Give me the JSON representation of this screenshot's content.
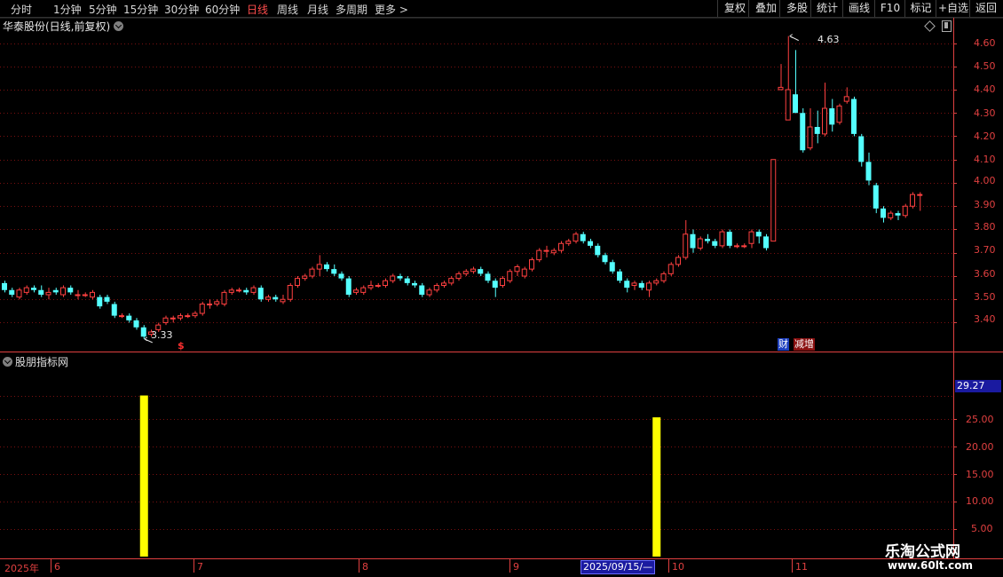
{
  "toolbar": {
    "periods": [
      "分时",
      "1分钟",
      "5分钟",
      "15分钟",
      "30分钟",
      "60分钟",
      "日线",
      "周线",
      "月线",
      "多周期",
      "更多 >"
    ],
    "active_period": "日线",
    "buttons": [
      "复权",
      "叠加",
      "多股",
      "统计",
      "画线",
      "F10",
      "标记",
      "+自选",
      "返回"
    ]
  },
  "chart": {
    "title": "华泰股份(日线,前复权)",
    "high_label": "4.63",
    "low_label": "3.33",
    "price_axis_ticks": [
      "4.60",
      "4.50",
      "4.40",
      "4.30",
      "4.20",
      "4.10",
      "4.00",
      "3.90",
      "3.80",
      "3.70",
      "3.60",
      "3.50",
      "3.40"
    ],
    "badges": {
      "cai": "财",
      "zeng": "减增"
    },
    "marker": "$"
  },
  "indicator": {
    "title": "股朋指标网",
    "current_value": "29.27",
    "axis_ticks": [
      "25.00",
      "20.00",
      "15.00",
      "10.00",
      "5.00"
    ]
  },
  "date_axis": {
    "year": "2025年",
    "months": [
      "6",
      "7",
      "8",
      "9",
      "10",
      "11"
    ],
    "cursor_date": "2025/09/15/—"
  },
  "watermark": {
    "name": "乐淘公式网",
    "url": "www.60lt.com"
  },
  "colors": {
    "up": "#ff4040",
    "down": "#54ffff",
    "indicator_bar": "#ffff00",
    "axis": "#e04040",
    "grid": "#7a1010"
  },
  "chart_data": {
    "type": "candlestick",
    "y_range": [
      3.3,
      4.66
    ],
    "candles": [
      [
        3.57,
        3.58,
        3.53,
        3.54
      ],
      [
        3.54,
        3.55,
        3.51,
        3.52
      ],
      [
        3.51,
        3.55,
        3.5,
        3.54
      ],
      [
        3.53,
        3.56,
        3.52,
        3.55
      ],
      [
        3.55,
        3.56,
        3.53,
        3.54
      ],
      [
        3.54,
        3.56,
        3.51,
        3.52
      ],
      [
        3.52,
        3.55,
        3.5,
        3.53
      ],
      [
        3.54,
        3.55,
        3.52,
        3.53
      ],
      [
        3.52,
        3.56,
        3.51,
        3.55
      ],
      [
        3.55,
        3.56,
        3.52,
        3.53
      ],
      [
        3.52,
        3.54,
        3.5,
        3.52
      ],
      [
        3.52,
        3.53,
        3.51,
        3.52
      ],
      [
        3.51,
        3.54,
        3.5,
        3.53
      ],
      [
        3.51,
        3.52,
        3.46,
        3.47
      ],
      [
        3.51,
        3.52,
        3.48,
        3.49
      ],
      [
        3.48,
        3.49,
        3.42,
        3.43
      ],
      [
        3.43,
        3.44,
        3.42,
        3.43
      ],
      [
        3.43,
        3.44,
        3.4,
        3.41
      ],
      [
        3.41,
        3.42,
        3.37,
        3.38
      ],
      [
        3.38,
        3.39,
        3.33,
        3.34
      ],
      [
        3.35,
        3.37,
        3.34,
        3.36
      ],
      [
        3.37,
        3.4,
        3.36,
        3.39
      ],
      [
        3.4,
        3.43,
        3.39,
        3.42
      ],
      [
        3.42,
        3.43,
        3.4,
        3.42
      ],
      [
        3.42,
        3.44,
        3.41,
        3.43
      ],
      [
        3.43,
        3.44,
        3.42,
        3.43
      ],
      [
        3.43,
        3.45,
        3.42,
        3.44
      ],
      [
        3.44,
        3.49,
        3.43,
        3.48
      ],
      [
        3.48,
        3.5,
        3.46,
        3.48
      ],
      [
        3.48,
        3.5,
        3.47,
        3.49
      ],
      [
        3.48,
        3.54,
        3.47,
        3.53
      ],
      [
        3.53,
        3.55,
        3.52,
        3.54
      ],
      [
        3.54,
        3.55,
        3.53,
        3.54
      ],
      [
        3.54,
        3.55,
        3.52,
        3.53
      ],
      [
        3.53,
        3.56,
        3.52,
        3.55
      ],
      [
        3.55,
        3.56,
        3.49,
        3.5
      ],
      [
        3.5,
        3.52,
        3.49,
        3.51
      ],
      [
        3.51,
        3.52,
        3.49,
        3.5
      ],
      [
        3.49,
        3.52,
        3.48,
        3.5
      ],
      [
        3.5,
        3.57,
        3.49,
        3.56
      ],
      [
        3.56,
        3.6,
        3.55,
        3.59
      ],
      [
        3.59,
        3.61,
        3.58,
        3.6
      ],
      [
        3.6,
        3.64,
        3.59,
        3.63
      ],
      [
        3.63,
        3.69,
        3.6,
        3.65
      ],
      [
        3.65,
        3.66,
        3.62,
        3.63
      ],
      [
        3.63,
        3.65,
        3.6,
        3.61
      ],
      [
        3.61,
        3.62,
        3.58,
        3.59
      ],
      [
        3.59,
        3.6,
        3.51,
        3.52
      ],
      [
        3.53,
        3.55,
        3.52,
        3.54
      ],
      [
        3.53,
        3.56,
        3.52,
        3.55
      ],
      [
        3.55,
        3.58,
        3.54,
        3.56
      ],
      [
        3.56,
        3.57,
        3.55,
        3.56
      ],
      [
        3.56,
        3.59,
        3.55,
        3.58
      ],
      [
        3.58,
        3.61,
        3.57,
        3.6
      ],
      [
        3.6,
        3.61,
        3.58,
        3.59
      ],
      [
        3.59,
        3.6,
        3.56,
        3.57
      ],
      [
        3.57,
        3.58,
        3.55,
        3.56
      ],
      [
        3.56,
        3.57,
        3.51,
        3.52
      ],
      [
        3.52,
        3.55,
        3.51,
        3.54
      ],
      [
        3.54,
        3.57,
        3.53,
        3.56
      ],
      [
        3.56,
        3.58,
        3.55,
        3.57
      ],
      [
        3.57,
        3.6,
        3.56,
        3.59
      ],
      [
        3.59,
        3.62,
        3.58,
        3.61
      ],
      [
        3.61,
        3.63,
        3.6,
        3.62
      ],
      [
        3.62,
        3.64,
        3.61,
        3.63
      ],
      [
        3.63,
        3.64,
        3.6,
        3.61
      ],
      [
        3.61,
        3.62,
        3.57,
        3.58
      ],
      [
        3.58,
        3.59,
        3.51,
        3.55
      ],
      [
        3.56,
        3.6,
        3.55,
        3.59
      ],
      [
        3.58,
        3.63,
        3.57,
        3.62
      ],
      [
        3.62,
        3.65,
        3.6,
        3.64
      ],
      [
        3.6,
        3.64,
        3.59,
        3.63
      ],
      [
        3.63,
        3.68,
        3.62,
        3.67
      ],
      [
        3.67,
        3.72,
        3.66,
        3.71
      ],
      [
        3.71,
        3.73,
        3.68,
        3.71
      ],
      [
        3.7,
        3.72,
        3.69,
        3.71
      ],
      [
        3.71,
        3.75,
        3.7,
        3.74
      ],
      [
        3.74,
        3.76,
        3.73,
        3.75
      ],
      [
        3.75,
        3.79,
        3.74,
        3.78
      ],
      [
        3.78,
        3.79,
        3.74,
        3.75
      ],
      [
        3.75,
        3.76,
        3.72,
        3.73
      ],
      [
        3.73,
        3.74,
        3.68,
        3.69
      ],
      [
        3.69,
        3.7,
        3.65,
        3.66
      ],
      [
        3.66,
        3.67,
        3.61,
        3.62
      ],
      [
        3.62,
        3.63,
        3.57,
        3.58
      ],
      [
        3.58,
        3.59,
        3.53,
        3.55
      ],
      [
        3.56,
        3.58,
        3.54,
        3.57
      ],
      [
        3.57,
        3.58,
        3.54,
        3.55
      ],
      [
        3.54,
        3.58,
        3.51,
        3.57
      ],
      [
        3.57,
        3.59,
        3.56,
        3.58
      ],
      [
        3.58,
        3.62,
        3.57,
        3.61
      ],
      [
        3.61,
        3.66,
        3.6,
        3.65
      ],
      [
        3.65,
        3.69,
        3.64,
        3.68
      ],
      [
        3.68,
        3.84,
        3.67,
        3.78
      ],
      [
        3.78,
        3.8,
        3.7,
        3.72
      ],
      [
        3.72,
        3.77,
        3.71,
        3.76
      ],
      [
        3.76,
        3.78,
        3.74,
        3.75
      ],
      [
        3.75,
        3.76,
        3.72,
        3.73
      ],
      [
        3.73,
        3.8,
        3.72,
        3.79
      ],
      [
        3.79,
        3.8,
        3.72,
        3.73
      ],
      [
        3.73,
        3.74,
        3.72,
        3.73
      ],
      [
        3.73,
        3.74,
        3.72,
        3.73
      ],
      [
        3.74,
        3.8,
        3.72,
        3.79
      ],
      [
        3.79,
        3.8,
        3.74,
        3.77
      ],
      [
        3.77,
        3.78,
        3.71,
        3.72
      ],
      [
        3.75,
        4.1,
        3.75,
        4.1
      ],
      [
        4.4,
        4.51,
        4.4,
        4.41
      ],
      [
        4.27,
        4.63,
        4.27,
        4.4
      ],
      [
        4.38,
        4.57,
        4.31,
        4.3
      ],
      [
        4.3,
        4.32,
        4.13,
        4.14
      ],
      [
        4.15,
        4.32,
        4.14,
        4.24
      ],
      [
        4.24,
        4.31,
        4.17,
        4.21
      ],
      [
        4.21,
        4.43,
        4.2,
        4.32
      ],
      [
        4.32,
        4.36,
        4.22,
        4.25
      ],
      [
        4.26,
        4.34,
        4.25,
        4.33
      ],
      [
        4.35,
        4.41,
        4.34,
        4.37
      ],
      [
        4.36,
        4.37,
        4.2,
        4.21
      ],
      [
        4.2,
        4.21,
        4.07,
        4.09
      ],
      [
        4.09,
        4.13,
        3.99,
        4.01
      ],
      [
        3.99,
        4.0,
        3.87,
        3.89
      ],
      [
        3.89,
        3.9,
        3.83,
        3.85
      ],
      [
        3.85,
        3.88,
        3.84,
        3.87
      ],
      [
        3.87,
        3.88,
        3.84,
        3.86
      ],
      [
        3.86,
        3.91,
        3.85,
        3.9
      ],
      [
        3.9,
        3.96,
        3.89,
        3.95
      ],
      [
        3.95,
        3.96,
        3.88,
        3.95
      ]
    ],
    "indicator_bars": [
      {
        "candle_index": 19,
        "value": 29.27
      },
      {
        "candle_index": 89,
        "value": 25.3
      }
    ],
    "indicator_range": [
      0,
      33
    ]
  }
}
